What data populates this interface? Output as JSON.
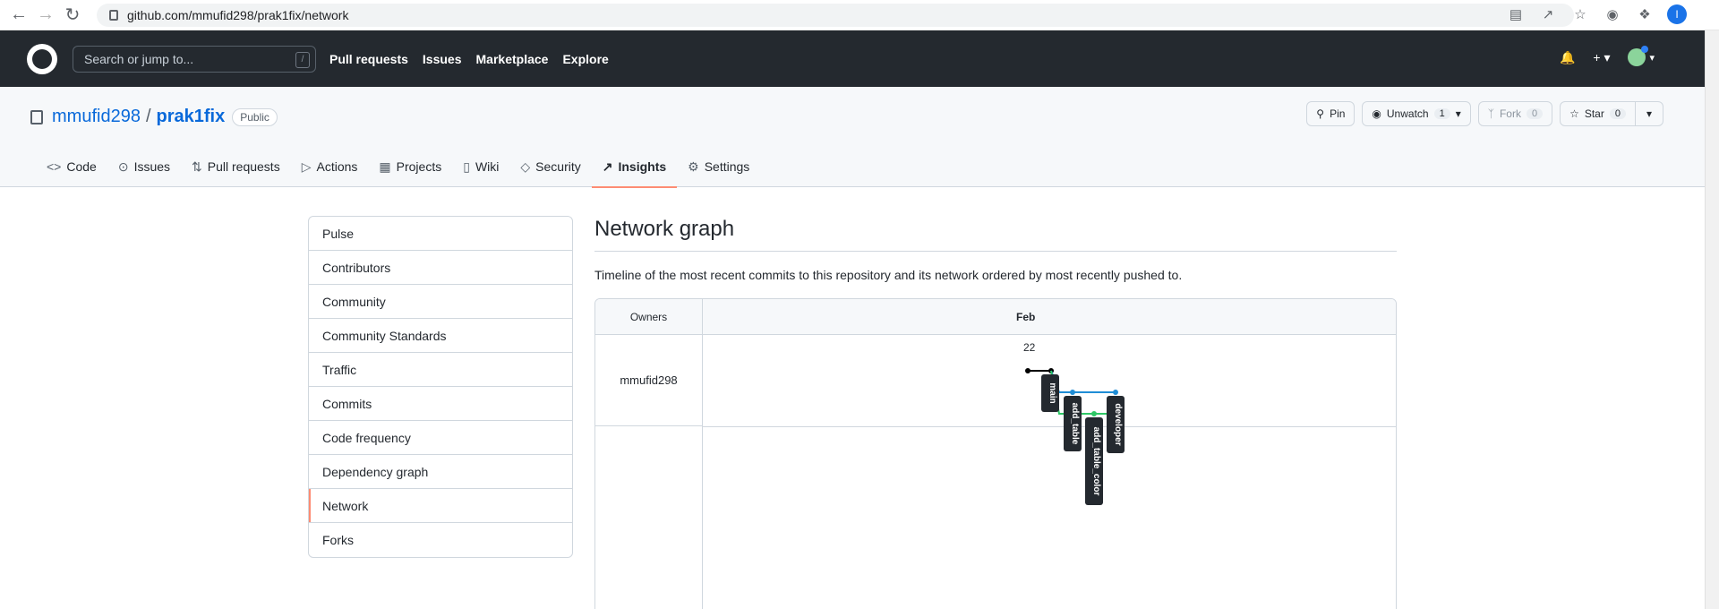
{
  "browser": {
    "url": "github.com/mmufid298/prak1fix/network",
    "profile_initial": "I",
    "icons": [
      "back-icon",
      "forward-icon",
      "reload-icon",
      "lock-icon",
      "translate-icon",
      "share-icon",
      "star-icon",
      "globe-icon",
      "extensions-icon"
    ]
  },
  "header": {
    "search_placeholder": "Search or jump to...",
    "search_shortcut": "/",
    "nav": [
      "Pull requests",
      "Issues",
      "Marketplace",
      "Explore"
    ],
    "bell": "🔔",
    "plus": "+ ▾",
    "avatar_caret": "▾"
  },
  "repo": {
    "owner": "mmufid298",
    "separator": "/",
    "name": "prak1fix",
    "visibility": "Public",
    "pin_label": "Pin",
    "unwatch_label": "Unwatch",
    "watch_count": "1",
    "fork_label": "Fork",
    "fork_count": "0",
    "star_label": "Star",
    "star_count": "0",
    "tabs": [
      {
        "label": "Code",
        "icon": "<>"
      },
      {
        "label": "Issues",
        "icon": "⊙"
      },
      {
        "label": "Pull requests",
        "icon": "⇅"
      },
      {
        "label": "Actions",
        "icon": "▷"
      },
      {
        "label": "Projects",
        "icon": "▦"
      },
      {
        "label": "Wiki",
        "icon": "▯"
      },
      {
        "label": "Security",
        "icon": "◇"
      },
      {
        "label": "Insights",
        "icon": "↗"
      },
      {
        "label": "Settings",
        "icon": "⚙"
      }
    ],
    "selected_tab": "Insights"
  },
  "sidebar": {
    "items": [
      "Pulse",
      "Contributors",
      "Community",
      "Community Standards",
      "Traffic",
      "Commits",
      "Code frequency",
      "Dependency graph",
      "Network",
      "Forks"
    ],
    "selected": "Network"
  },
  "main": {
    "title": "Network graph",
    "description": "Timeline of the most recent commits to this repository and its network ordered by most recently pushed to."
  },
  "graph": {
    "owners_header": "Owners",
    "month": "Feb",
    "day": "22",
    "owner": "mmufid298",
    "branches": [
      "main",
      "add_table",
      "add_table_color",
      "developer"
    ],
    "colors": {
      "main": "#000000",
      "add_table": "#1f8dd6",
      "add_table_color": "#2ec866",
      "developer": "#1f8dd6"
    }
  }
}
